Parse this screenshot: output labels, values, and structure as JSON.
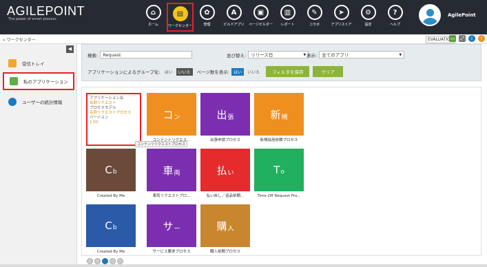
{
  "header": {
    "logo_word": "AGILEPOINT",
    "logo_tag": "The power of smart process",
    "nav": [
      {
        "icon": "⌂",
        "label": "ホーム",
        "active": false
      },
      {
        "icon": "▤",
        "label": "ワークセンター",
        "active": true
      },
      {
        "icon": "✿",
        "label": "管理",
        "active": false
      },
      {
        "icon": "A",
        "label": "ビルドアプリ",
        "active": false
      },
      {
        "icon": "▣",
        "label": "ページビルダー",
        "active": false
      },
      {
        "icon": "▥",
        "label": "レポート",
        "active": false
      },
      {
        "icon": "✎",
        "label": "コラボ",
        "active": false
      },
      {
        "icon": "➤",
        "label": "アプリストア",
        "active": false
      },
      {
        "icon": "⚙",
        "label": "設定",
        "active": false
      },
      {
        "icon": "?",
        "label": "ヘルプ",
        "active": false
      }
    ],
    "user_name": "AgilePoint"
  },
  "subbar": {
    "breadcrumb": "» ワークセンター",
    "eval": "EVALUATION"
  },
  "sidebar": {
    "collapse": "◀",
    "items": [
      {
        "label": "受信トレイ",
        "color": "#f0a830",
        "active": false
      },
      {
        "label": "私のアプリケーション",
        "color": "#5bb047",
        "active": true
      },
      {
        "label": "ユーザーの統計情報",
        "color": "#1c79c0",
        "active": false
      }
    ]
  },
  "filter": {
    "search_label": "検索:",
    "search_value": "Request",
    "sort_label": "並び替え:",
    "sort_value": "リリース日",
    "show_label": "表示:",
    "show_value": "全てのアプリ",
    "group_label": "アプリケーションによるグループ化:",
    "yes": "はい",
    "no": "いいえ",
    "pages_label": "ページ数を表示:",
    "save_filter": "フィルタを保存",
    "clear": "クリア"
  },
  "info_card": {
    "k1": "アプリケーション名",
    "v1": "名刺リクエスト",
    "k2": "プロセスモデル",
    "v2": "名刺リクエストプロセス",
    "k3": "バージョン",
    "v3": "1.00"
  },
  "tooltip": "コンテンツリクエストプロセス",
  "tiles": [
    {
      "big": "コ",
      "small": "ン",
      "caption": "コンテントリクエス...",
      "color": "#ef8f1f"
    },
    {
      "big": "出",
      "small": "張",
      "caption": "出張申請プロセス",
      "color": "#7b2fb0"
    },
    {
      "big": "新",
      "small": "規",
      "caption": "新規採用依頼プロセス",
      "color": "#ef8f1f"
    },
    {
      "big": "C",
      "small": "b",
      "caption": "Created By Me",
      "color": "#6b4a3a"
    },
    {
      "big": "車",
      "small": "両",
      "caption": "車両リクエストプロ...",
      "color": "#7b2fb0"
    },
    {
      "big": "払",
      "small": "い",
      "caption": "払い戻し／返品依頼...",
      "color": "#e52b2b"
    },
    {
      "big": "T",
      "small": "o",
      "caption": "Time Off Request Pro...",
      "color": "#20b060"
    },
    {
      "big": "C",
      "small": "b",
      "caption": "Created By Me",
      "color": "#2a5aa8"
    },
    {
      "big": "サ",
      "small": "ー",
      "caption": "サービス要求プロセス",
      "color": "#7b2fb0"
    },
    {
      "big": "購",
      "small": "入",
      "caption": "購入依頼プロセス",
      "color": "#c8862f"
    }
  ]
}
